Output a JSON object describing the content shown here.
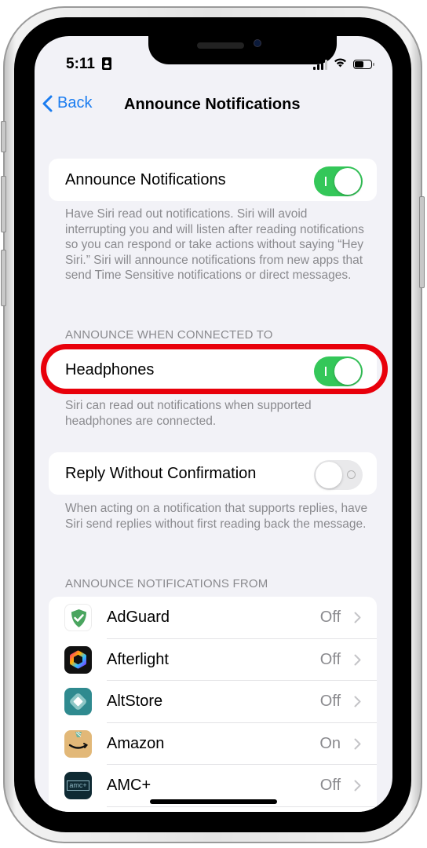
{
  "status_bar": {
    "time": "5:11",
    "icons": [
      "contact-card-icon",
      "cellular-signal-icon",
      "wifi-icon",
      "battery-icon"
    ]
  },
  "nav": {
    "back_label": "Back",
    "title": "Announce Notifications"
  },
  "announce": {
    "label": "Announce Notifications",
    "enabled": true,
    "footnote": "Have Siri read out notifications. Siri will avoid interrupting you and will listen after reading notifications so you can respond or take actions without saying “Hey Siri.” Siri will announce notifications from new apps that send Time Sensitive notifications or direct messages."
  },
  "connected": {
    "header": "ANNOUNCE WHEN CONNECTED TO",
    "label": "Headphones",
    "enabled": true,
    "footnote": "Siri can read out notifications when supported headphones are connected.",
    "highlight_color": "#e8000b"
  },
  "reply": {
    "label": "Reply Without Confirmation",
    "enabled": false,
    "footnote": "When acting on a notification that supports replies, have Siri send replies without first reading back the message."
  },
  "apps": {
    "header": "ANNOUNCE NOTIFICATIONS FROM",
    "items": [
      {
        "name": "AdGuard",
        "value": "Off",
        "icon": "adguard-shield-icon"
      },
      {
        "name": "Afterlight",
        "value": "Off",
        "icon": "afterlight-aperture-icon"
      },
      {
        "name": "AltStore",
        "value": "Off",
        "icon": "altstore-diamond-icon"
      },
      {
        "name": "Amazon",
        "value": "On",
        "icon": "amazon-box-icon"
      },
      {
        "name": "AMC+",
        "value": "Off",
        "icon": "amc-plus-icon"
      }
    ]
  },
  "colors": {
    "accent": "#1a7cf0",
    "toggle_on": "#34c759",
    "toggle_off": "#e9e9eb",
    "background": "#f2f2f7",
    "secondary_text": "#8a8a8e"
  },
  "amc_icon_text": "amc+"
}
